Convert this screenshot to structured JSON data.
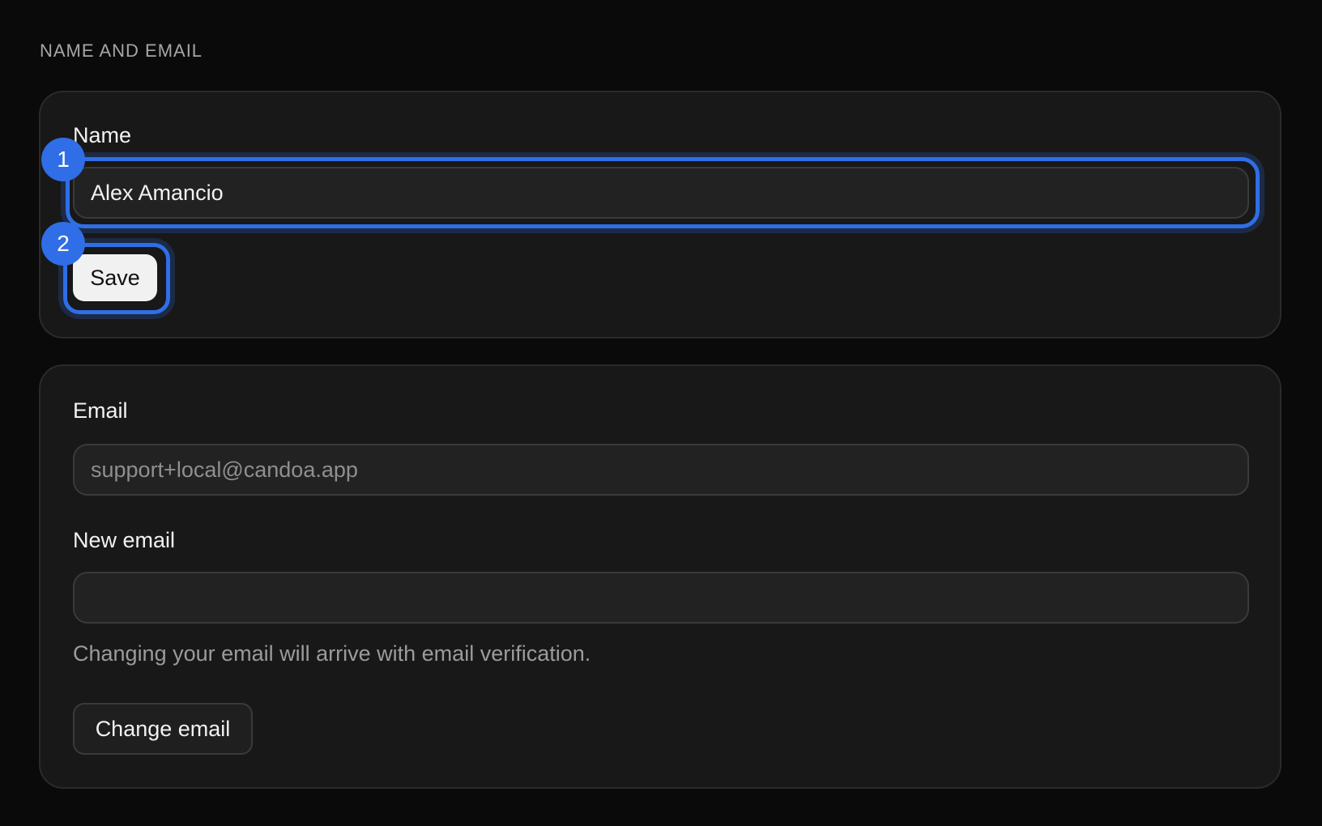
{
  "section": {
    "heading": "NAME AND EMAIL"
  },
  "name_card": {
    "label": "Name",
    "value": "Alex Amancio",
    "save_label": "Save"
  },
  "email_card": {
    "email_label": "Email",
    "email_value": "support+local@candoa.app",
    "new_email_label": "New email",
    "new_email_value": "",
    "help_text": "Changing your email will arrive with email verification.",
    "change_label": "Change email"
  },
  "annotations": {
    "badge_1": "1",
    "badge_2": "2",
    "highlight_color": "#2f6ee6"
  }
}
